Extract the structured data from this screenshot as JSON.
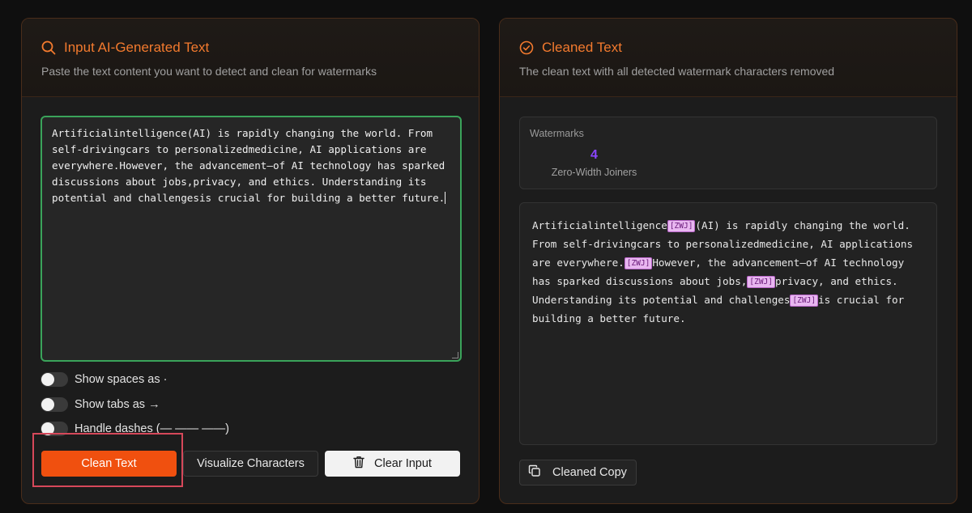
{
  "input_panel": {
    "title": "Input AI-Generated Text",
    "description": "Paste the text content you want to detect and clean for watermarks",
    "text_value": "Artificialintelligence(AI) is rapidly changing the world. From self-drivingcars to personalizedmedicine, AI applications are everywhere.However, the advancement—of AI technology has sparked discussions about jobs,privacy, and ethics. Understanding its potential and challengesis crucial for building a better future.",
    "toggles": [
      {
        "label": "Show spaces as ·",
        "on": false
      },
      {
        "label": "Show tabs as →",
        "on": false
      },
      {
        "label": "Handle dashes (— —— ——)",
        "on": false
      }
    ],
    "buttons": {
      "clean": "Clean Text",
      "visualize": "Visualize Characters",
      "clear": "Clear Input"
    },
    "icon": "search-icon"
  },
  "output_panel": {
    "title": "Cleaned Text",
    "description": "The clean text with all detected watermark characters removed",
    "icon": "check-circle-icon",
    "watermarks": {
      "label": "Watermarks",
      "count": "4",
      "type": "Zero-Width Joiners"
    },
    "marker_label": "[ZWJ]",
    "output_segments": [
      "Artificialintelligence",
      "(AI) is rapidly changing the world. From self-drivingcars to personalizedmedicine, AI applications are everywhere.",
      "However, the advancement—of AI technology has sparked discussions about jobs,",
      "privacy, and ethics. Understanding its potential and challenges",
      "is crucial for building a better future."
    ],
    "copy_button": "Cleaned Copy"
  },
  "colors": {
    "accent": "#f37a2e",
    "clean_button": "#f0500f",
    "watermark_count": "#8a45ff",
    "zwj_marker": "#e8b6f0",
    "highlight_box": "#d6485a"
  }
}
